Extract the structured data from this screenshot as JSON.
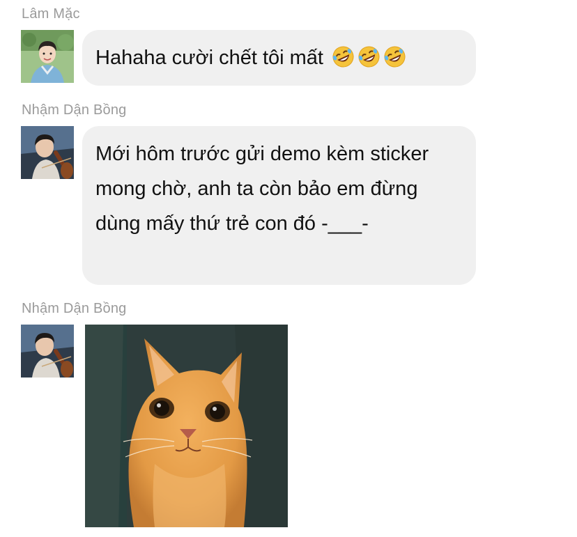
{
  "messages": [
    {
      "sender": "Lâm Mặc",
      "avatar_icon": "avatar-boy-blue-shirt",
      "text": "Hahaha cười chết tôi mất",
      "emojis": [
        "rolling-on-floor-laughing-icon",
        "rolling-on-floor-laughing-icon",
        "rolling-on-floor-laughing-icon"
      ]
    },
    {
      "sender": "Nhậm Dận Bồng",
      "avatar_icon": "avatar-cellist",
      "text": "Mới hôm trước gửi demo kèm sticker mong chờ, anh ta còn bảo em đừng dùng mấy thứ trẻ con đó -___-"
    },
    {
      "sender": "Nhậm Dận Bồng",
      "avatar_icon": "avatar-cellist",
      "sticker_icon": "grumpy-cat-peeking-sticker"
    }
  ],
  "colors": {
    "bubble_bg": "#f0f0f0",
    "name_text": "#9a9a9a",
    "message_text": "#111111"
  }
}
